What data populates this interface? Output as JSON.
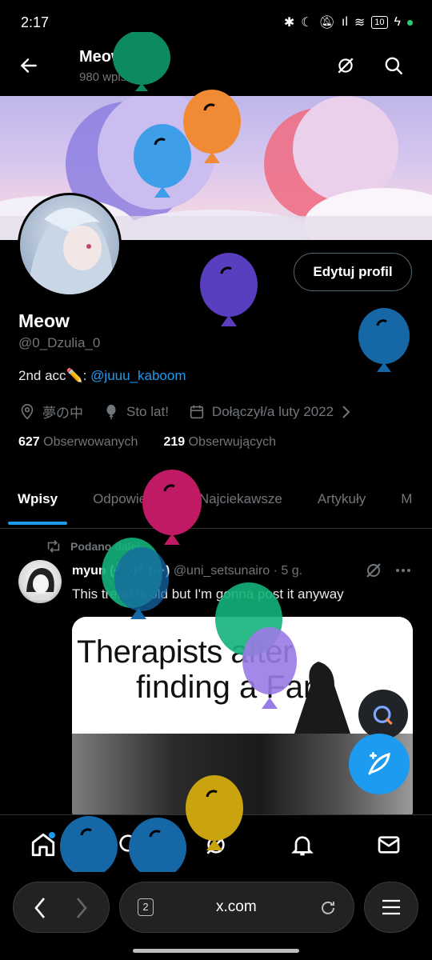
{
  "status_bar": {
    "time": "2:17",
    "battery": "10"
  },
  "header": {
    "title": "Meow",
    "subtitle": "980 wpisów"
  },
  "profile": {
    "edit_button": "Edytuj profil",
    "name": "Meow",
    "handle": "@0_Dzulia_0",
    "bio_text": "2nd acc✏️: ",
    "bio_link": "@juuu_kaboom",
    "location": "夢の中",
    "birthday": "Sto lat!",
    "joined": "Dołączył/a luty 2022",
    "following_count": "627",
    "following_label": "Obserwowanych",
    "followers_count": "219",
    "followers_label": "Obserwujących"
  },
  "tabs": [
    {
      "label": "Wpisy",
      "active": true
    },
    {
      "label": "Odpowiedzi",
      "active": false
    },
    {
      "label": "Najciekawsze",
      "active": false
    },
    {
      "label": "Artykuły",
      "active": false
    },
    {
      "label": "M",
      "active": false
    }
  ],
  "post": {
    "repost_label": "Podano dalej",
    "author": "myun (╯_·)╯ (·-·)",
    "author_handle": "@uni_setsunairo",
    "time": "· 5 g.",
    "text": "This trend is old but I'm gonna post it anyway",
    "image_caption_line1": "Therapists after",
    "image_caption_line2": "finding a    Fan"
  },
  "browser": {
    "url": "x.com",
    "tab_count": "2"
  },
  "colors": {
    "accent": "#1d9bf0",
    "background": "#000000",
    "muted_text": "#71767b",
    "balloons": [
      "#0e8a5f",
      "#f08a35",
      "#3e9fe8",
      "#5a3ec0",
      "#1667a6",
      "#c01a64",
      "#14b37a",
      "#c9a40e",
      "#9a7be6"
    ]
  },
  "icons": {
    "back": "arrow-left-icon",
    "grok": "grok-icon",
    "search": "search-icon",
    "location": "location-pin-icon",
    "balloon": "balloon-icon",
    "calendar": "calendar-icon",
    "repost": "repost-icon",
    "more": "more-dots-icon",
    "compose": "compose-icon",
    "home": "home-icon",
    "notifications": "bell-icon",
    "messages": "mail-icon",
    "browser_back": "chevron-left-icon",
    "browser_forward": "chevron-right-icon",
    "reload": "reload-icon",
    "menu": "hamburger-menu-icon"
  }
}
